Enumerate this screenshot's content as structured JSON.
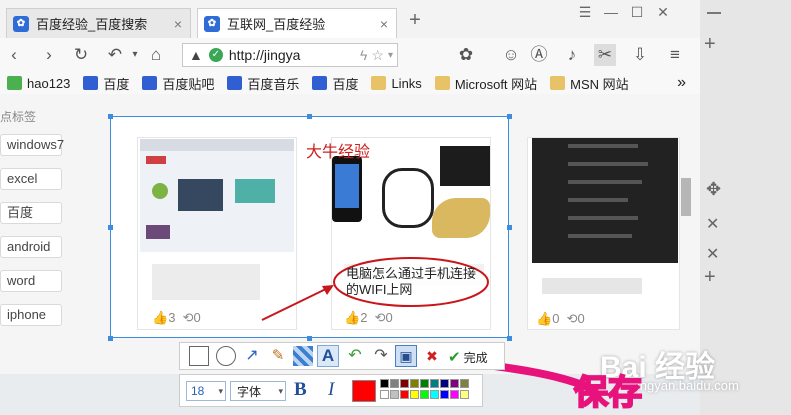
{
  "tabs": [
    {
      "title": "百度经验_百度搜索",
      "active": false
    },
    {
      "title": "互联网_百度经验",
      "active": true
    }
  ],
  "new_tab_label": "+",
  "close_glyph": "×",
  "window_controls": [
    "☰",
    "—",
    "☐",
    "✕"
  ],
  "url": "http://jingya",
  "bookmarks": [
    {
      "label": "hao123",
      "icon": "hao123-icon"
    },
    {
      "label": "百度",
      "icon": "paw-icon"
    },
    {
      "label": "百度贴吧",
      "icon": "paw-icon"
    },
    {
      "label": "百度音乐",
      "icon": "paw-icon"
    },
    {
      "label": "百度",
      "icon": "paw-icon"
    },
    {
      "label": "Links",
      "icon": "folder-icon"
    },
    {
      "label": "Microsoft 网站",
      "icon": "folder-icon"
    },
    {
      "label": "MSN 网站",
      "icon": "folder-icon"
    }
  ],
  "bookmarks_more": "»",
  "sidebar_title": "点标签",
  "tags": [
    "windows7",
    "excel",
    "百度",
    "android",
    "word",
    "iphone"
  ],
  "cards": [
    {
      "likes": "3",
      "shares": "0"
    },
    {
      "likes": "2",
      "shares": "0",
      "overlay_text": "大牛经验",
      "annotation": "电脑怎么通过手机连接的WIFI上网"
    },
    {
      "likes": "0",
      "shares": "0"
    }
  ],
  "annotation_toolbar": {
    "done_label": "完成",
    "font_size": "18",
    "font_label": "字体",
    "bold_label": "B",
    "italic_label": "I",
    "text_tool_label": "A",
    "current_color": "#ff0000",
    "palette": [
      "#000000",
      "#808080",
      "#800000",
      "#808000",
      "#008000",
      "#008080",
      "#000080",
      "#800080",
      "#808040",
      "#ffffff",
      "#c0c0c0",
      "#ff0000",
      "#ffff00",
      "#00ff00",
      "#00ffff",
      "#0000ff",
      "#ff00ff",
      "#ffff80"
    ]
  },
  "callout_label": "保存",
  "watermark": {
    "brand": "Bai 经验",
    "sub": "jingyan.baidu.com"
  },
  "accent_color": "#e8127c",
  "selection_color": "#3c8dde"
}
